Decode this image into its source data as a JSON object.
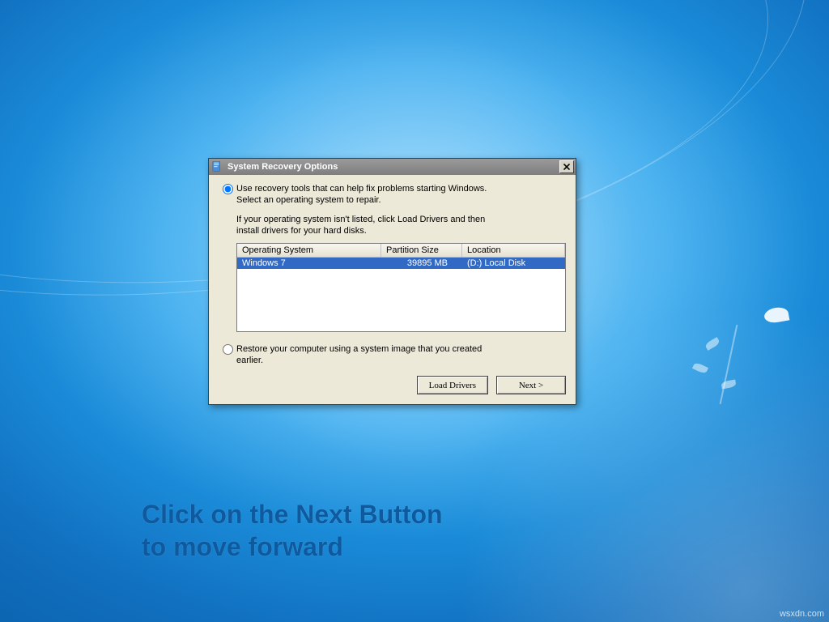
{
  "dialog": {
    "title": "System Recovery Options",
    "option1_line1": "Use recovery tools that can help fix problems starting Windows.",
    "option1_line2": "Select an operating system to repair.",
    "description_line1": "If your operating system isn't listed, click Load Drivers and then",
    "description_line2": "install drivers for your hard disks.",
    "columns": {
      "os": "Operating System",
      "partition": "Partition Size",
      "location": "Location"
    },
    "row": {
      "os": "Windows 7",
      "partition": "39895 MB",
      "location": "(D:) Local Disk"
    },
    "option2_line1": "Restore your computer using a system image that you created",
    "option2_line2": "earlier.",
    "buttons": {
      "load_drivers": "Load Drivers",
      "next": "Next >"
    }
  },
  "caption_line1": "Click on the Next Button",
  "caption_line2": "to move forward",
  "watermark": "wsxdn.com"
}
